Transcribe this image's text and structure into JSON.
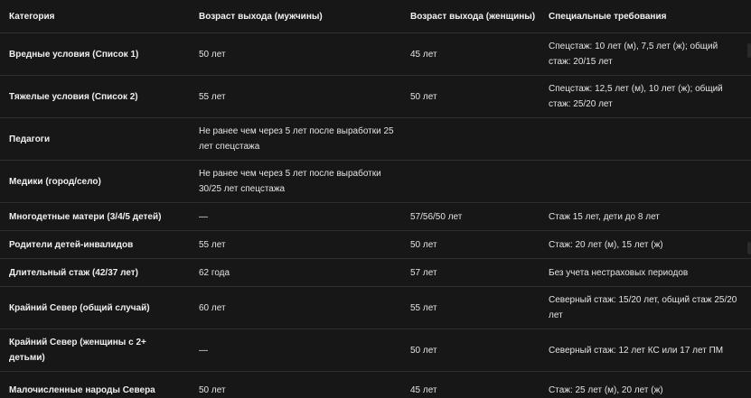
{
  "table": {
    "headers": [
      "Категория",
      "Возраст выхода (мужчины)",
      "Возраст выхода (женщины)",
      "Специальные требования"
    ],
    "rows": [
      {
        "category": "Вредные условия (Список 1)",
        "men": "50 лет",
        "women": "45 лет",
        "requirements": "Спецстаж: 10 лет (м), 7,5 лет (ж); общий стаж: 20/15 лет"
      },
      {
        "category": "Тяжелые условия (Список 2)",
        "men": "55 лет",
        "women": "50 лет",
        "requirements": "Спецстаж: 12,5 лет (м), 10 лет (ж); общий стаж: 25/20 лет"
      },
      {
        "category": "Педагоги",
        "men": "Не ранее чем через 5 лет после выработки 25 лет спецстажа",
        "women": "",
        "requirements": ""
      },
      {
        "category": "Медики (город/село)",
        "men": "Не ранее чем через 5 лет после выработки 30/25 лет спецстажа",
        "women": "",
        "requirements": ""
      },
      {
        "category": "Многодетные матери (3/4/5 детей)",
        "men": "—",
        "women": "57/56/50 лет",
        "requirements": "Стаж 15 лет, дети до 8 лет"
      },
      {
        "category": "Родители детей-инвалидов",
        "men": "55 лет",
        "women": "50 лет",
        "requirements": "Стаж: 20 лет (м), 15 лет (ж)"
      },
      {
        "category": "Длительный стаж (42/37 лет)",
        "men": "62 года",
        "women": "57 лет",
        "requirements": "Без учета нестраховых периодов"
      },
      {
        "category": "Крайний Север (общий случай)",
        "men": "60 лет",
        "women": "55 лет",
        "requirements": "Северный стаж: 15/20 лет, общий стаж 25/20 лет"
      },
      {
        "category": "Крайний Север (женщины с 2+ детьми)",
        "men": "—",
        "women": "50 лет",
        "requirements": "Северный стаж: 12 лет КС или 17 лет ПМ"
      },
      {
        "category": "Малочисленные народы Севера",
        "men": "50 лет",
        "women": "45 лет",
        "requirements": "Стаж: 25 лет (м), 20 лет (ж)"
      }
    ]
  }
}
